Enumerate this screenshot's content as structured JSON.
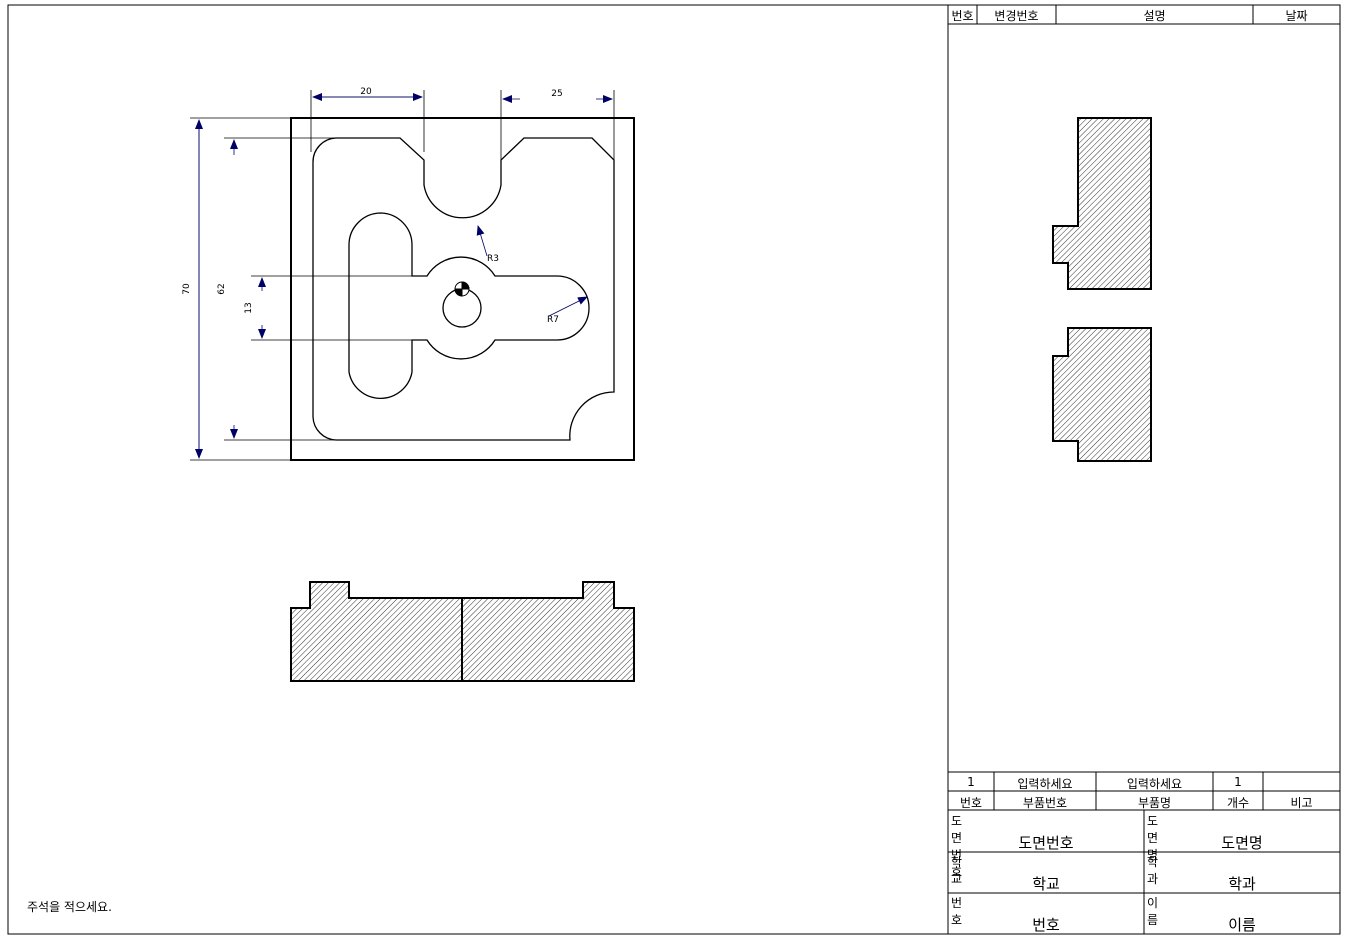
{
  "revision_table": {
    "headers": [
      "번호",
      "변경번호",
      "설명",
      "날짜"
    ]
  },
  "dimensions": {
    "top_left": "20",
    "top_right": "25",
    "radius_small": "R3",
    "radius_large": "R7",
    "overall_height": "70",
    "inner_height": "62",
    "slot_height": "13"
  },
  "parts_list": {
    "row": {
      "no": "1",
      "part_no": "입력하세요",
      "part_name": "입력하세요",
      "qty": "1",
      "remark": ""
    },
    "headers": {
      "no": "번호",
      "part_no": "부품번호",
      "part_name": "부품명",
      "qty": "개수",
      "remark": "비고"
    }
  },
  "title_block": {
    "drawing_no_label": "도면번호",
    "drawing_no_value": "도면번호",
    "drawing_name_label": "도면명",
    "drawing_name_value": "도면명",
    "school_label": "학교",
    "school_value": "학교",
    "dept_label": "학과",
    "dept_value": "학과",
    "number_label": "번호",
    "number_value": "번호",
    "name_label": "이름",
    "name_value": "이름"
  },
  "note": "주석을 적으세요."
}
